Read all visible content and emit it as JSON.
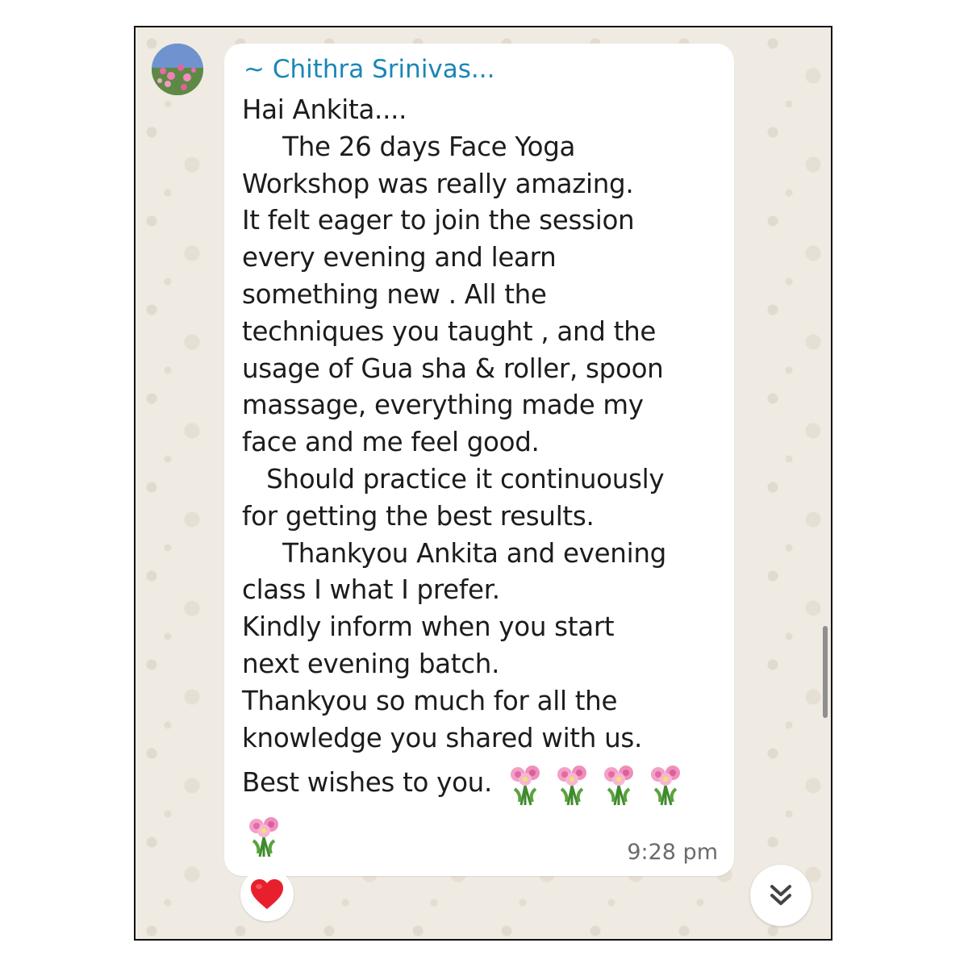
{
  "message": {
    "sender": "~ Chithra Srinivas...",
    "lines": [
      "Hai Ankita....",
      "     The 26 days Face Yoga",
      "Workshop was really amazing.",
      "It felt eager to join the session",
      "every evening and learn",
      "something new . All the",
      "techniques you taught , and the",
      "usage of Gua sha & roller, spoon",
      "massage, everything made my",
      "face and me feel good.",
      "   Should practice it continuously",
      "for getting the best results.",
      "     Thankyou Ankita and evening",
      "class I what I prefer.",
      "Kindly inform when you start",
      "next evening batch.",
      "Thankyou so much for all the",
      "knowledge you shared with us."
    ],
    "closing": "Best wishes to you.",
    "emoji_icons": [
      "bouquet-icon",
      "bouquet-icon",
      "bouquet-icon",
      "bouquet-icon",
      "bouquet-icon"
    ],
    "time": "9:28 pm"
  },
  "reaction": {
    "icon": "red-heart-icon"
  },
  "controls": {
    "scroll_down_icon": "double-chevron-down-icon"
  },
  "colors": {
    "chat_background": "#efeae2",
    "bubble": "#ffffff",
    "sender_name": "#1a86b8",
    "text": "#1c1c1c",
    "timestamp": "#6b6b6b",
    "heart": "#e8202e"
  }
}
